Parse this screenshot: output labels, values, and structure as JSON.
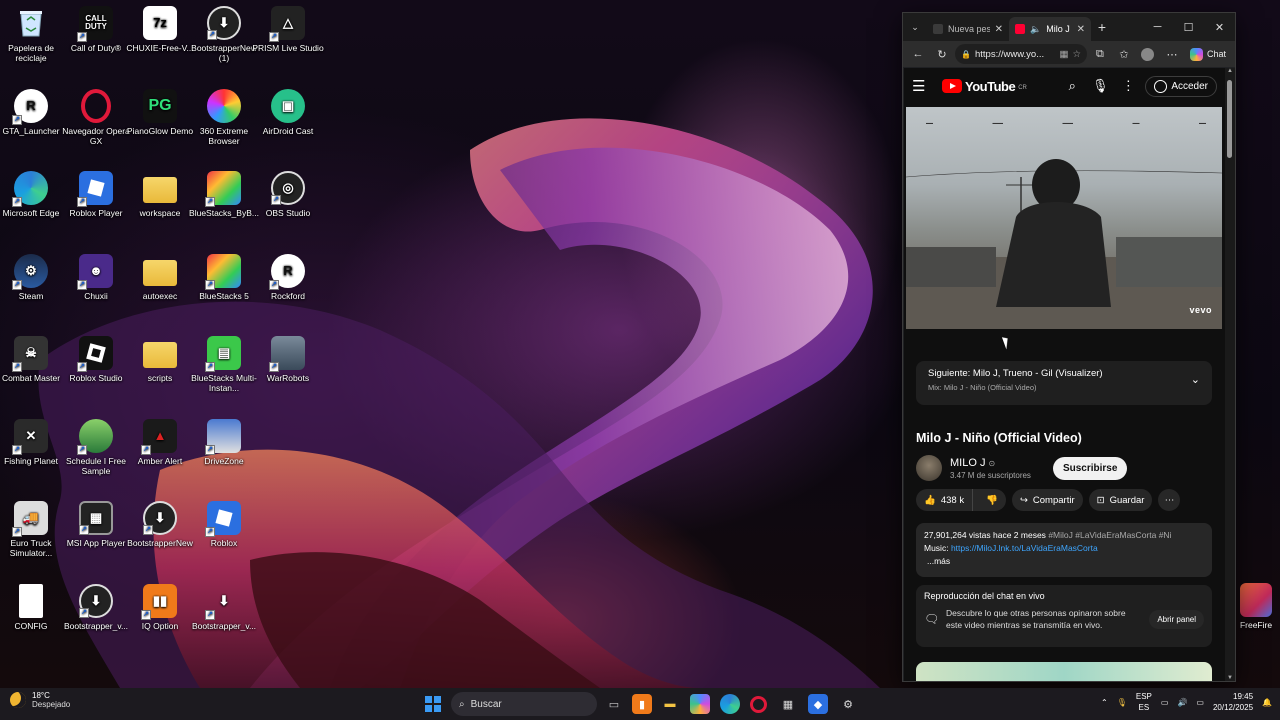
{
  "desktop": {
    "icons": [
      {
        "label": "Papelera de reciclaje",
        "icon": "recycle-bin-icon"
      },
      {
        "label": "Call of Duty®",
        "icon": "call-of-duty-icon"
      },
      {
        "label": "CHUXIE-Free-V...",
        "icon": "7zip-icon"
      },
      {
        "label": "BootstrapperNew (1)",
        "icon": "bootstrapper-icon"
      },
      {
        "label": "PRISM Live Studio",
        "icon": "prism-live-icon"
      },
      {
        "label": "GTA_Launcher",
        "icon": "rockstar-icon"
      },
      {
        "label": "Navegador Opera GX",
        "icon": "opera-gx-icon"
      },
      {
        "label": "PianoGlow Demo",
        "icon": "pianoglow-icon"
      },
      {
        "label": "360 Extreme Browser",
        "icon": "360-browser-icon"
      },
      {
        "label": "AirDroid Cast",
        "icon": "airdroid-icon"
      },
      {
        "label": "Microsoft Edge",
        "icon": "edge-icon"
      },
      {
        "label": "Roblox Player",
        "icon": "roblox-icon"
      },
      {
        "label": "workspace",
        "icon": "folder-icon"
      },
      {
        "label": "BlueStacks_ByB...",
        "icon": "bluestacks-icon"
      },
      {
        "label": "OBS Studio",
        "icon": "obs-icon"
      },
      {
        "label": "Steam",
        "icon": "steam-icon"
      },
      {
        "label": "Chuxii",
        "icon": "chuxii-icon"
      },
      {
        "label": "autoexec",
        "icon": "folder-icon"
      },
      {
        "label": "BlueStacks 5",
        "icon": "bluestacks-icon"
      },
      {
        "label": "Rockford",
        "icon": "rockstar-icon"
      },
      {
        "label": "Combat Master",
        "icon": "combat-master-icon"
      },
      {
        "label": "Roblox Studio",
        "icon": "roblox-studio-icon"
      },
      {
        "label": "scripts",
        "icon": "folder-icon"
      },
      {
        "label": "BlueStacks Multi-Instan...",
        "icon": "bluestacks-multi-icon"
      },
      {
        "label": "WarRobots",
        "icon": "warrobots-icon"
      },
      {
        "label": "Fishing Planet",
        "icon": "fishing-planet-icon"
      },
      {
        "label": "Schedule I Free Sample",
        "icon": "schedule-icon"
      },
      {
        "label": "Amber Alert",
        "icon": "amber-alert-icon"
      },
      {
        "label": "DriveZone",
        "icon": "drivezone-icon"
      },
      {
        "label": "Euro Truck Simulator...",
        "icon": "euro-truck-icon"
      },
      {
        "label": "MSI App Player",
        "icon": "msi-app-player-icon"
      },
      {
        "label": "BootstrapperNew",
        "icon": "bootstrapper-icon"
      },
      {
        "label": "Roblox",
        "icon": "roblox-icon"
      },
      {
        "label": "CONFIG",
        "icon": "file-icon"
      },
      {
        "label": "Bootstrapper_v...",
        "icon": "bootstrapper-icon"
      },
      {
        "label": "IQ Option",
        "icon": "iq-option-icon"
      },
      {
        "label": "Bootstrapper_v...",
        "icon": "bootstrapper-icon"
      }
    ],
    "freefire_label": "FreeFire"
  },
  "browser": {
    "tabs": [
      {
        "title": "Nueva pesta",
        "active": false
      },
      {
        "title": "Milo J -",
        "active": true
      }
    ],
    "url": "https://www.yo...",
    "chat_label": "Chat"
  },
  "youtube": {
    "logo_text": "YouTube",
    "country": "CR",
    "sign_in": "Acceder",
    "next": {
      "prefix": "Siguiente:",
      "title": "Milo J, Trueno - Gil (Visualizer)",
      "mix": "Mix: Milo J - Niño (Official Video)"
    },
    "video_watermark": "vevo",
    "video_title": "Milo J - Niño (Official Video)",
    "channel": {
      "name": "MILO J",
      "verified": "⊙",
      "subscribers": "3.47 M de suscriptores",
      "subscribe": "Suscribirse"
    },
    "actions": {
      "likes": "438 k",
      "share": "Compartir",
      "save": "Guardar"
    },
    "description": {
      "views": "27,901,264 vistas",
      "ago": "hace 2 meses",
      "tags": "#MiloJ #LaVidaEraMasCorta #Ni",
      "music_label": "Music:",
      "music_link": "https://MiloJ.lnk.to/LaVidaEraMasCorta",
      "more": "...más"
    },
    "live_chat": {
      "title": "Reproducción del chat en vivo",
      "text": "Descubre lo que otras personas opinaron sobre este video mientras se transmitía en vivo.",
      "open": "Abrir panel"
    }
  },
  "taskbar": {
    "weather_temp": "18°C",
    "weather_desc": "Despejado",
    "search_placeholder": "Buscar",
    "lang_1": "ESP",
    "lang_2": "ES",
    "time": "19:45",
    "date": "20/12/2025"
  }
}
